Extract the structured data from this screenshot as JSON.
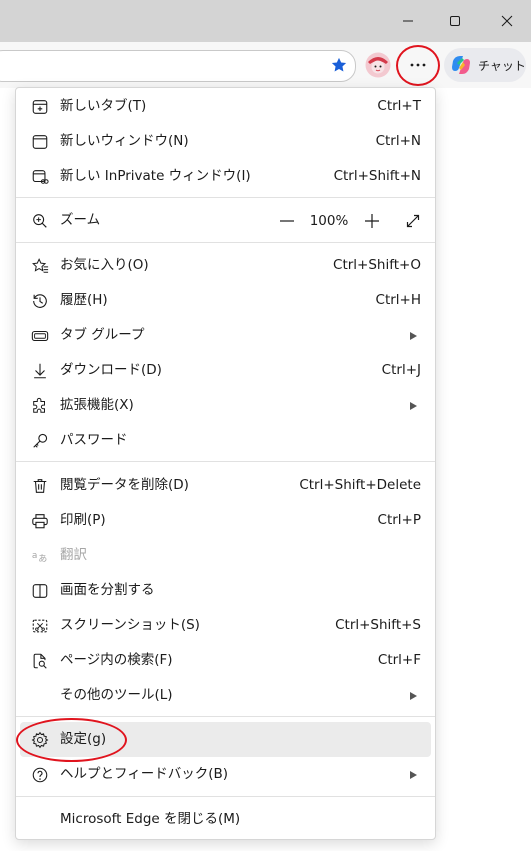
{
  "toolbar": {
    "chat_label": "チャット"
  },
  "menu": {
    "new_tab": {
      "label": "新しいタブ(T)",
      "shortcut": "Ctrl+T"
    },
    "new_window": {
      "label": "新しいウィンドウ(N)",
      "shortcut": "Ctrl+N"
    },
    "inprivate": {
      "label": "新しい InPrivate ウィンドウ(I)",
      "shortcut": "Ctrl+Shift+N"
    },
    "zoom": {
      "label": "ズーム",
      "value": "100%"
    },
    "favorites": {
      "label": "お気に入り(O)",
      "shortcut": "Ctrl+Shift+O"
    },
    "history": {
      "label": "履歴(H)",
      "shortcut": "Ctrl+H"
    },
    "tab_groups": {
      "label": "タブ グループ"
    },
    "downloads": {
      "label": "ダウンロード(D)",
      "shortcut": "Ctrl+J"
    },
    "extensions": {
      "label": "拡張機能(X)"
    },
    "passwords": {
      "label": "パスワード"
    },
    "clear_data": {
      "label": "閲覧データを削除(D)",
      "shortcut": "Ctrl+Shift+Delete"
    },
    "print": {
      "label": "印刷(P)",
      "shortcut": "Ctrl+P"
    },
    "translate": {
      "label": "翻訳"
    },
    "split_screen": {
      "label": "画面を分割する"
    },
    "screenshot": {
      "label": "スクリーンショット(S)",
      "shortcut": "Ctrl+Shift+S"
    },
    "find": {
      "label": "ページ内の検索(F)",
      "shortcut": "Ctrl+F"
    },
    "more_tools": {
      "label": "その他のツール(L)"
    },
    "settings": {
      "label": "設定(g)"
    },
    "help": {
      "label": "ヘルプとフィードバック(B)"
    },
    "close_edge": {
      "label": "Microsoft Edge を閉じる(M)"
    }
  },
  "colors": {
    "annotation_red": "#e0141e",
    "highlight": "#ebebeb",
    "favorite_star": "#1a5fd8"
  }
}
